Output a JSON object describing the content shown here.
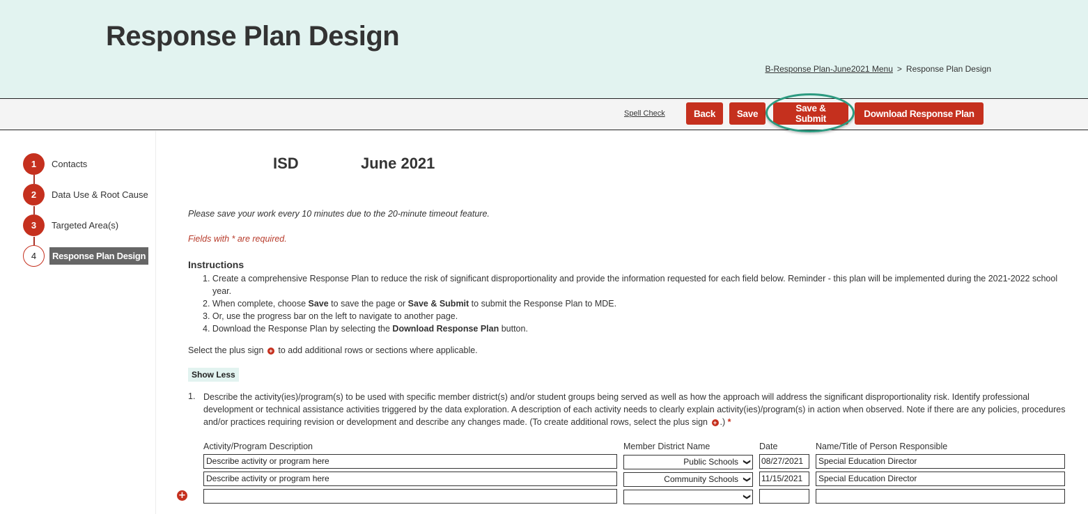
{
  "header": {
    "title": "Response Plan Design",
    "breadcrumb": {
      "parent": "B-Response Plan-June2021 Menu",
      "separator": ">",
      "current": "Response Plan Design"
    }
  },
  "toolbar": {
    "spell_check": "Spell Check",
    "back": "Back",
    "save": "Save",
    "save_submit": "Save & Submit",
    "download": "Download Response Plan",
    "accent_color": "#c5301e",
    "highlight_color": "#2c9a80"
  },
  "sidebar": {
    "steps": [
      {
        "number": "1",
        "label": "Contacts",
        "state": "complete"
      },
      {
        "number": "2",
        "label": "Data Use & Root Cause",
        "state": "complete"
      },
      {
        "number": "3",
        "label": "Targeted Area(s)",
        "state": "complete"
      },
      {
        "number": "4",
        "label": "Response Plan Design",
        "state": "current"
      }
    ]
  },
  "main": {
    "entity": "ISD",
    "period": "June 2021",
    "save_note": "Please save your work every 10 minutes due to the 20-minute timeout feature.",
    "required_note": "Fields with * are required.",
    "instructions": {
      "title": "Instructions",
      "items": [
        {
          "num": "1.",
          "pre": "Create a comprehensive Response Plan to reduce the risk of significant disproportionality and provide the information requested for each field below. Reminder - this plan will be implemented during the 2021-2022 school year.",
          "b1": "",
          "mid": "",
          "b2": "",
          "post": ""
        },
        {
          "num": "2.",
          "pre": "When complete, choose ",
          "b1": "Save",
          "mid": " to save the page or ",
          "b2": "Save & Submit",
          "post": " to submit the Response Plan to MDE."
        },
        {
          "num": "3.",
          "pre": "Or, use the progress bar on the left to navigate to another page.",
          "b1": "",
          "mid": "",
          "b2": "",
          "post": ""
        },
        {
          "num": "4.",
          "pre": "Download the Response Plan by selecting the ",
          "b1": "Download Response Plan",
          "mid": " button.",
          "b2": "",
          "post": ""
        }
      ]
    },
    "plus_note_pre": "Select the plus sign",
    "plus_note_post": "to add additional rows or sections where applicable.",
    "show_less": "Show Less",
    "question": {
      "number": "1.",
      "text": "Describe the activity(ies)/program(s) to be used with specific member district(s) and/or student groups being served as well as how the approach will address the significant disproportionality risk. Identify professional development or technical assistance activities triggered by the data exploration. A description of each activity needs to clearly explain activity(ies)/program(s) in action when observed. Note if there are any policies, procedures and/or practices requiring revision or development and describe any changes made. (To create additional rows, select the plus sign",
      "text_end": ".)",
      "required_mark": "*"
    },
    "table": {
      "headers": [
        "Activity/Program Description",
        "Member District Name",
        "Date",
        "Name/Title of Person Responsible"
      ],
      "rows": [
        {
          "description": "Describe activity or program here",
          "district": "Public Schools",
          "date": "08/27/2021",
          "person": "Special Education Director"
        },
        {
          "description": "Describe activity or program here",
          "district": "Community Schools",
          "date": "11/15/2021",
          "person": "Special Education Director"
        },
        {
          "description": "",
          "district": "",
          "date": "",
          "person": ""
        }
      ]
    },
    "icons": {
      "plus": "plus-circle-icon",
      "chevron": "chevron-down-icon"
    }
  }
}
